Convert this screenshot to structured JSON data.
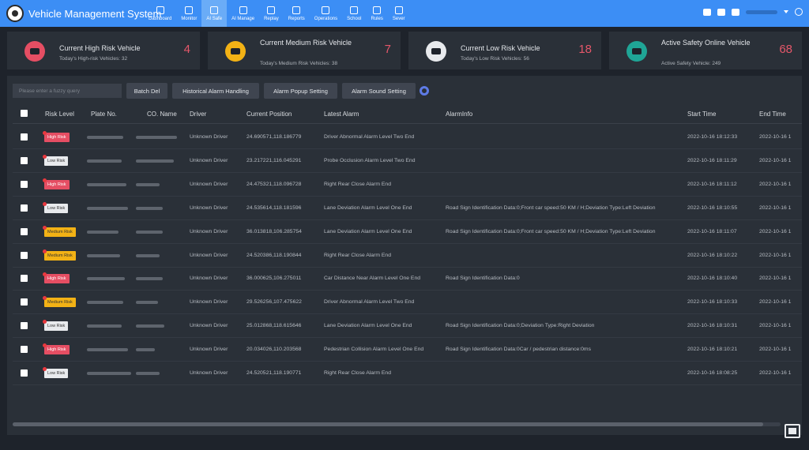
{
  "app": {
    "title": "Vehicle Management System"
  },
  "nav": [
    {
      "label": "Dashboard",
      "icon": "dashboard-icon"
    },
    {
      "label": "Monitor",
      "icon": "monitor-icon"
    },
    {
      "label": "AI Safe",
      "icon": "shield-icon",
      "active": true
    },
    {
      "label": "AI Manage",
      "icon": "ai-manage-icon"
    },
    {
      "label": "Replay",
      "icon": "replay-icon"
    },
    {
      "label": "Reports",
      "icon": "reports-icon"
    },
    {
      "label": "Operations",
      "icon": "operations-icon"
    },
    {
      "label": "School",
      "icon": "school-icon"
    },
    {
      "label": "Rules",
      "icon": "rules-icon"
    },
    {
      "label": "Sever",
      "icon": "server-icon"
    }
  ],
  "cards": [
    {
      "title": "Current High Risk Vehicle",
      "sub_label": "Today's High-risk Vehicles:",
      "sub_value": "32",
      "count": "4",
      "icon_color": "#e54e63"
    },
    {
      "title": "Current Medium Risk Vehicle",
      "sub_label": "Today's Medium Risk Vehicles:",
      "sub_value": "38",
      "count": "7",
      "icon_color": "#f3b215"
    },
    {
      "title": "Current Low Risk Vehicle",
      "sub_label": "Today's Low Risk Vehicles:",
      "sub_value": "56",
      "count": "18",
      "icon_color": "#e8eaed"
    },
    {
      "title": "Active Safety Online Vehicle",
      "sub_label": "Active Safety Vehicle:",
      "sub_value": "249",
      "count": "68",
      "icon_color": "#1fa596"
    }
  ],
  "toolbar": {
    "search_placeholder": "Please enter a fuzzy query",
    "batch_del": "Batch Del",
    "historical": "Historical Alarm Handling",
    "popup": "Alarm Popup Setting",
    "sound": "Alarm Sound Setting"
  },
  "table": {
    "headers": [
      "Risk Level",
      "Plate No.",
      "CO. Name",
      "Driver",
      "Current Position",
      "Latest Alarm",
      "AlarmInfo",
      "Start Time",
      "End Time"
    ],
    "rows": [
      {
        "risk": "High Risk",
        "level": "high",
        "driver": "Unknown Driver",
        "position": "24.690571,118.186779",
        "alarm": "Driver Abnormal Alarm Level Two End",
        "info": "",
        "start": "2022-10-16 18:12:33",
        "end": "2022-10-16 1"
      },
      {
        "risk": "Low Risk",
        "level": "low",
        "driver": "Unknown Driver",
        "position": "23.217221,116.045291",
        "alarm": "Probe Occlusion Alarm Level Two End",
        "info": "",
        "start": "2022-10-16 18:11:29",
        "end": "2022-10-16 1"
      },
      {
        "risk": "High Risk",
        "level": "high",
        "driver": "Unknown Driver",
        "position": "24.475321,118.096728",
        "alarm": "Right Rear Close Alarm End",
        "info": "",
        "start": "2022-10-16 18:11:12",
        "end": "2022-10-16 1"
      },
      {
        "risk": "Low Risk",
        "level": "low",
        "driver": "Unknown Driver",
        "position": "24.535614,118.181596",
        "alarm": "Lane Deviation Alarm Level One End",
        "info": "Road Sign Identification Data:0;Front car speed:50 KM / H;Deviation Type:Left Deviation",
        "start": "2022-10-16 18:10:55",
        "end": "2022-10-16 1"
      },
      {
        "risk": "Medium Risk",
        "level": "medium",
        "driver": "Unknown Driver",
        "position": "36.013818,106.285754",
        "alarm": "Lane Deviation Alarm Level One End",
        "info": "Road Sign Identification Data:0;Front car speed:50 KM / H;Deviation Type:Left Deviation",
        "start": "2022-10-16 18:11:07",
        "end": "2022-10-16 1"
      },
      {
        "risk": "Medium Risk",
        "level": "medium",
        "driver": "Unknown Driver",
        "position": "24.520386,118.190844",
        "alarm": "Right Rear Close Alarm End",
        "info": "",
        "start": "2022-10-16 18:10:22",
        "end": "2022-10-16 1"
      },
      {
        "risk": "High Risk",
        "level": "high",
        "driver": "Unknown Driver",
        "position": "36.000625,106.275011",
        "alarm": "Car Distance Near Alarm Level One End",
        "info": "Road Sign Identification Data:0",
        "start": "2022-10-16 18:10:40",
        "end": "2022-10-16 1"
      },
      {
        "risk": "Medium Risk",
        "level": "medium",
        "driver": "Unknown Driver",
        "position": "29.526256,107.475622",
        "alarm": "Driver Abnormal Alarm Level Two End",
        "info": "",
        "start": "2022-10-16 18:10:33",
        "end": "2022-10-16 1"
      },
      {
        "risk": "Low Risk",
        "level": "low",
        "driver": "Unknown Driver",
        "position": "25.012868,118.615646",
        "alarm": "Lane Deviation Alarm Level One End",
        "info": "Road Sign Identification Data:0;Deviation Type:Right Deviation",
        "start": "2022-10-16 18:10:31",
        "end": "2022-10-16 1"
      },
      {
        "risk": "High Risk",
        "level": "high",
        "driver": "Unknown Driver",
        "position": "20.034026,110.203568",
        "alarm": "Pedestrian Collision Alarm Level One End",
        "info": "Road Sign Identification Data:0Car / pedestrian distance:0ms",
        "start": "2022-10-16 18:10:21",
        "end": "2022-10-16 1"
      },
      {
        "risk": "Low Risk",
        "level": "low",
        "driver": "Unknown Driver",
        "position": "24.520521,118.190771",
        "alarm": "Right Rear Close Alarm End",
        "info": "",
        "start": "2022-10-16 18:08:25",
        "end": "2022-10-16 1"
      }
    ]
  }
}
